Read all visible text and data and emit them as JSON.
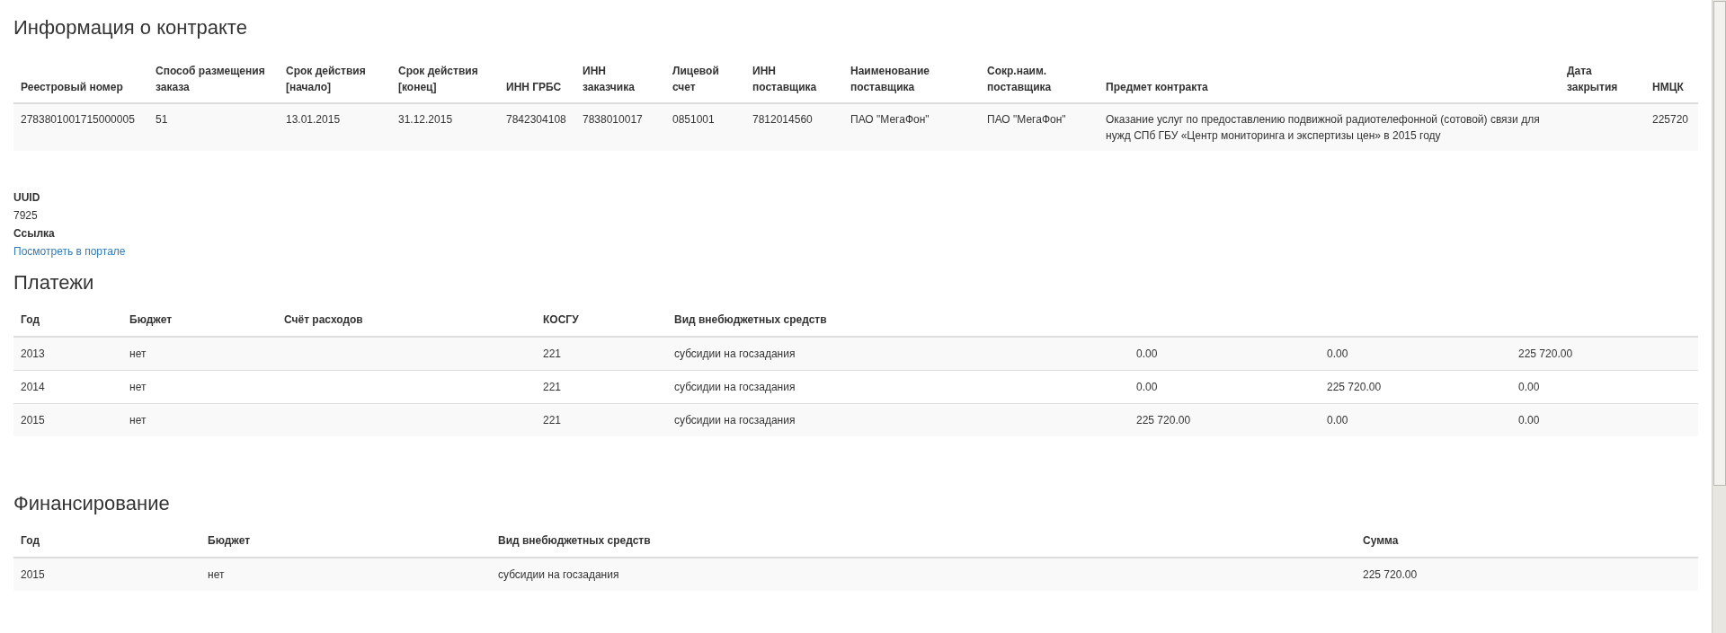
{
  "contract": {
    "title": "Информация о контракте",
    "table": {
      "columns": [
        "Реестровый номер",
        "Способ размещения заказа",
        "Срок действия [начало]",
        "Срок действия [конец]",
        "ИНН ГРБС",
        "ИНН заказчика",
        "Лицевой счет",
        "ИНН поставщика",
        "Наименование поставщика",
        "Сокр.наим. поставщика",
        "Предмет контракта",
        "Дата закрытия",
        "НМЦК"
      ],
      "rows": [
        [
          "2783801001715000005",
          "51",
          "13.01.2015",
          "31.12.2015",
          "7842304108",
          "7838010017",
          "0851001",
          "7812014560",
          "ПАО \"МегаФон\"",
          "ПАО \"МегаФон\"",
          "Оказание услуг по предоставлению подвижной радиотелефонной (сотовой) связи для нужд СПб ГБУ «Центр мониторинга и экспертизы цен» в 2015 году",
          null,
          "225720"
        ]
      ]
    }
  },
  "details": [
    {
      "label": "UUID",
      "value": "7925",
      "kind": "text"
    },
    {
      "label": "Ссылка",
      "value": "Посмотреть в портале",
      "kind": "link"
    }
  ],
  "payments": {
    "title": "Платежи",
    "table": {
      "columns": [
        "Год",
        "Бюджет",
        "Счёт расходов",
        "КОСГУ",
        "Вид внебюджетных средств"
      ],
      "rows": [
        [
          "2013",
          "нет",
          null,
          "221",
          "субсидии на госзадания",
          "0.00",
          "0.00",
          "225 720.00"
        ],
        [
          "2014",
          "нет",
          null,
          "221",
          "субсидии на госзадания",
          "0.00",
          "225 720.00",
          "0.00"
        ],
        [
          "2015",
          "нет",
          null,
          "221",
          "субсидии на госзадания",
          "225 720.00",
          "0.00",
          "0.00"
        ]
      ]
    }
  },
  "financing": {
    "title": "Финансирование",
    "table": {
      "columns": [
        "Год",
        "Бюджет",
        "Вид внебюджетных средств",
        "Сумма"
      ],
      "rows": [
        [
          "2015",
          "нет",
          "субсидии на госзадания",
          "225 720.00"
        ]
      ]
    }
  }
}
